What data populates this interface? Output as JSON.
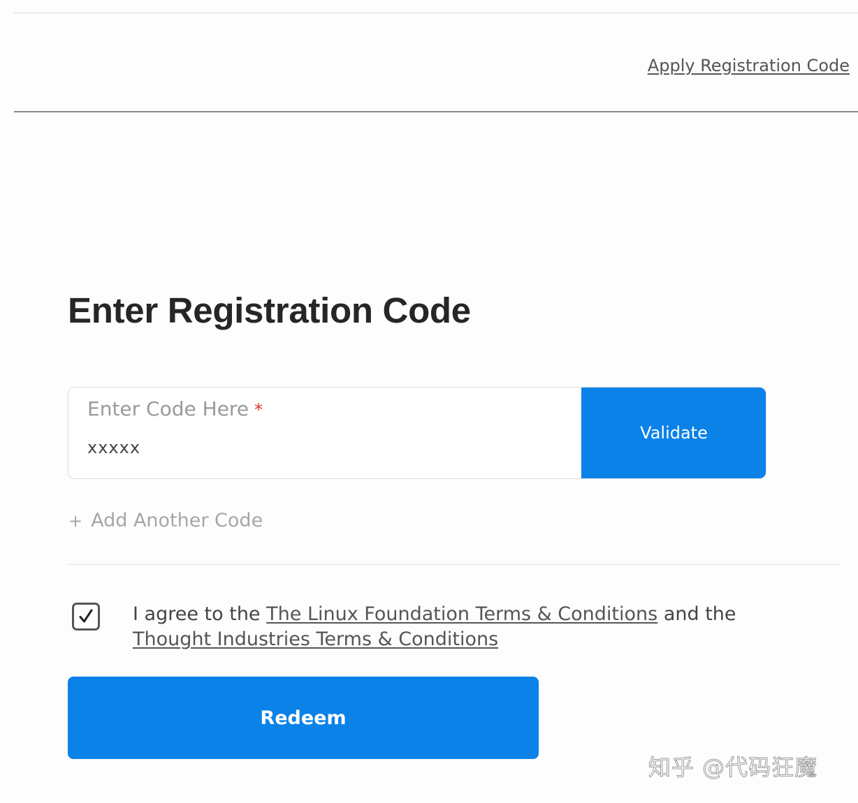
{
  "header": {
    "link_label": "Apply Registration Code"
  },
  "main": {
    "title": "Enter Registration Code",
    "code_field": {
      "label": "Enter Code Here",
      "required_mark": "*",
      "value": "xxxxx"
    },
    "validate_label": "Validate",
    "add_code_icon": "+",
    "add_code_label": "Add Another Code",
    "agreement": {
      "checked": true,
      "prefix": "I agree to the",
      "link1": "The Linux Foundation Terms & Conditions",
      "middle": "and the",
      "link2": "Thought Industries Terms & Conditions"
    },
    "redeem_label": "Redeem"
  },
  "watermark": "知乎 @代码狂魔",
  "colors": {
    "primary": "#0a82e8",
    "required": "#e03131"
  },
  "icons": [
    "plus-icon",
    "checkmark-icon"
  ]
}
